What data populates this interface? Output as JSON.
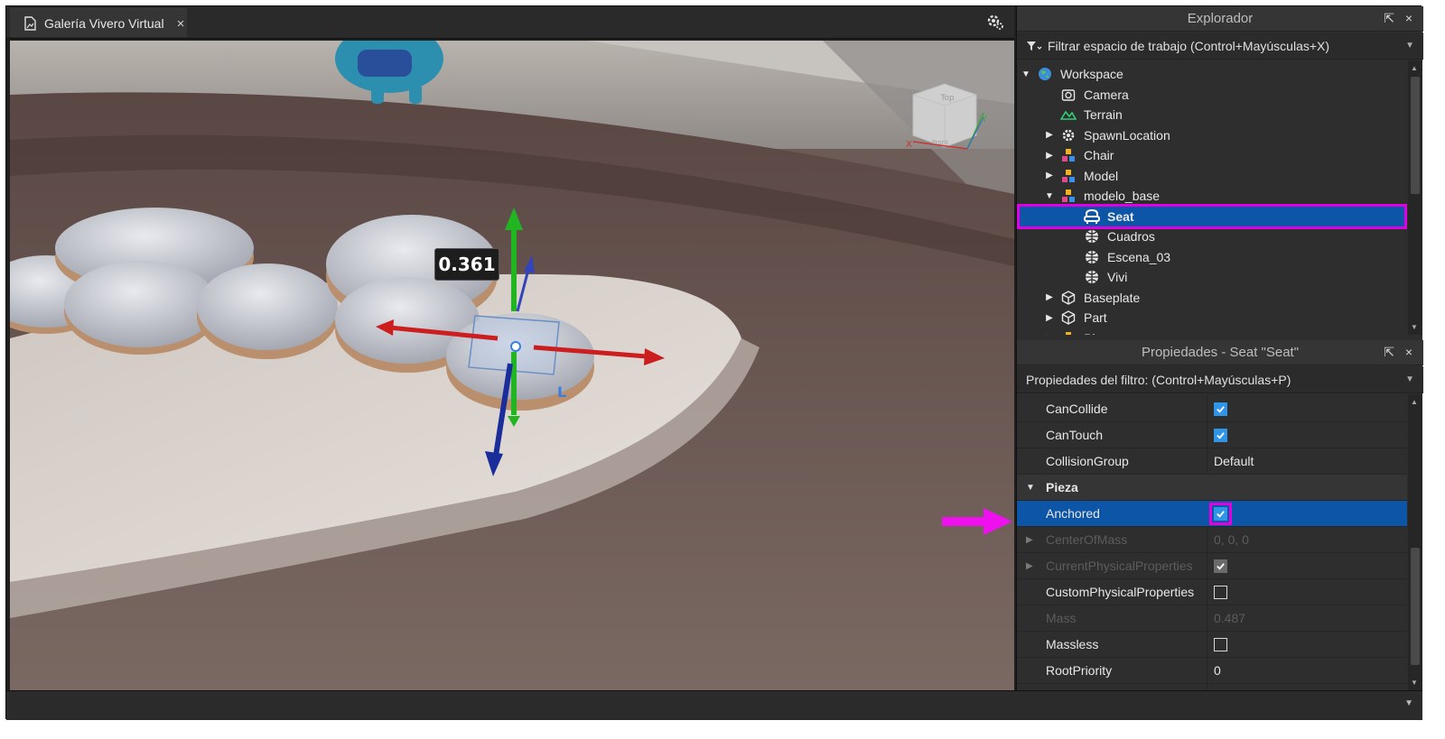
{
  "document_tab": {
    "title": "Galería Vivero Virtual",
    "close": "×"
  },
  "viewport": {
    "measure_value": "0.361",
    "view_cube_top": "Top",
    "view_cube_front": "Front"
  },
  "explorer": {
    "title": "Explorador",
    "window_controls": "⇱ ×",
    "filter_placeholder": "Filtrar espacio de trabajo (Control+Mayúsculas+X)",
    "items": [
      {
        "label": "Workspace",
        "icon": "globe-icon",
        "expanded": true
      },
      {
        "label": "Camera",
        "icon": "camera-icon"
      },
      {
        "label": "Terrain",
        "icon": "terrain-icon"
      },
      {
        "label": "SpawnLocation",
        "icon": "spawn-gear-icon",
        "expandable": true
      },
      {
        "label": "Chair",
        "icon": "model-icon",
        "expandable": true
      },
      {
        "label": "Model",
        "icon": "model-icon",
        "expandable": true
      },
      {
        "label": "modelo_base",
        "icon": "model-icon",
        "expanded": true
      },
      {
        "label": "Seat",
        "icon": "seat-icon",
        "selected": true
      },
      {
        "label": "Cuadros",
        "icon": "mesh-icon"
      },
      {
        "label": "Escena_03",
        "icon": "mesh-icon"
      },
      {
        "label": "Vivi",
        "icon": "mesh-icon"
      },
      {
        "label": "Baseplate",
        "icon": "part-icon",
        "expandable": true
      },
      {
        "label": "Part",
        "icon": "part-icon",
        "expandable": true
      }
    ],
    "partial_next": "Pl"
  },
  "properties": {
    "title": "Propiedades - Seat \"Seat\"",
    "window_controls": "⇱ ×",
    "filter_placeholder": "Propiedades del filtro: (Control+Mayúsculas+P)",
    "rows": [
      {
        "name": "CanCollide",
        "type": "checkbox",
        "checked": true
      },
      {
        "name": "CanTouch",
        "type": "checkbox",
        "checked": true
      },
      {
        "name": "CollisionGroup",
        "type": "text",
        "value": "Default"
      },
      {
        "name": "Pieza",
        "type": "category"
      },
      {
        "name": "Anchored",
        "type": "checkbox",
        "checked": true,
        "highlighted": true
      },
      {
        "name": "CenterOfMass",
        "type": "text",
        "value": "0, 0, 0",
        "dim": true,
        "expandable": true
      },
      {
        "name": "CurrentPhysicalProperties",
        "type": "checkbox",
        "checked": true,
        "dim": true,
        "expandable": true
      },
      {
        "name": "CustomPhysicalProperties",
        "type": "checkbox",
        "checked": false
      },
      {
        "name": "Mass",
        "type": "text",
        "value": "0.487",
        "dim": true
      },
      {
        "name": "Massless",
        "type": "checkbox",
        "checked": false
      },
      {
        "name": "RootPriority",
        "type": "text",
        "value": "0"
      }
    ]
  },
  "colors": {
    "selection": "#0d55a6",
    "annotation": "#e000e0",
    "checkbox": "#2f95e8",
    "panel_bg": "#2e2e2e"
  }
}
